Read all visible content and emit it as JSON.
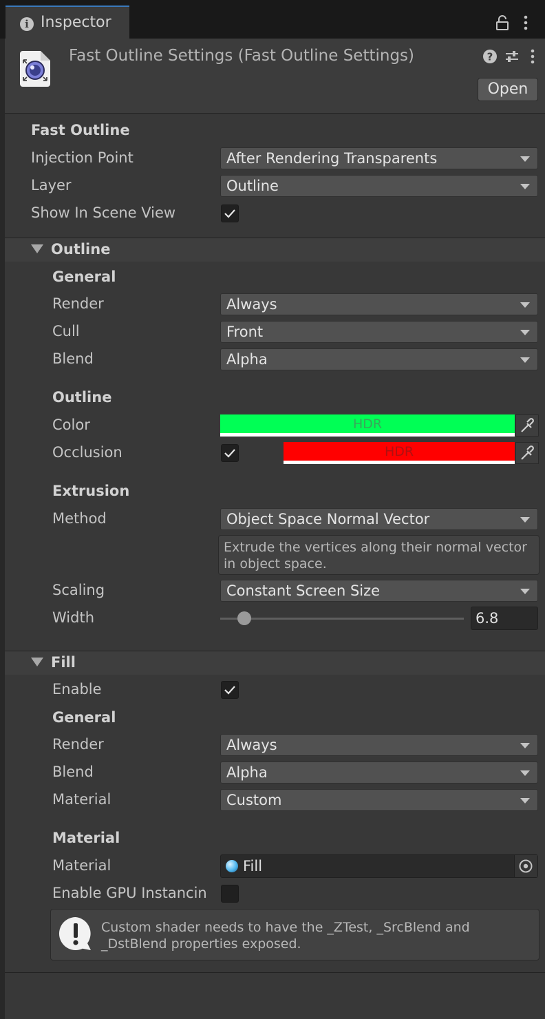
{
  "tab": {
    "title": "Inspector"
  },
  "header": {
    "title": "Fast Outline Settings (Fast Outline Settings)",
    "open_label": "Open",
    "icons": [
      "help-icon",
      "preset-icon",
      "menu-icon"
    ]
  },
  "fast_outline": {
    "heading": "Fast Outline",
    "injection_point": {
      "label": "Injection Point",
      "value": "After Rendering Transparents"
    },
    "layer": {
      "label": "Layer",
      "value": "Outline"
    },
    "show_in_scene_view": {
      "label": "Show In Scene View",
      "checked": true
    }
  },
  "outline": {
    "heading": "Outline",
    "general": {
      "heading": "General",
      "render": {
        "label": "Render",
        "value": "Always"
      },
      "cull": {
        "label": "Cull",
        "value": "Front"
      },
      "blend": {
        "label": "Blend",
        "value": "Alpha"
      }
    },
    "outline_group": {
      "heading": "Outline",
      "color": {
        "label": "Color",
        "hdr": "HDR",
        "swatch": "#00ff55"
      },
      "occlusion": {
        "label": "Occlusion",
        "checked": true,
        "hdr": "HDR",
        "swatch": "#ff0000"
      }
    },
    "extrusion": {
      "heading": "Extrusion",
      "method": {
        "label": "Method",
        "value": "Object Space Normal Vector"
      },
      "method_help_line1": "Extrude the vertices along their normal vector",
      "method_help_line2": "in object space.",
      "scaling": {
        "label": "Scaling",
        "value": "Constant Screen Size"
      },
      "width": {
        "label": "Width",
        "value": "6.8",
        "fraction": 0.09
      }
    }
  },
  "fill": {
    "heading": "Fill",
    "enable": {
      "label": "Enable",
      "checked": true
    },
    "general": {
      "heading": "General",
      "render": {
        "label": "Render",
        "value": "Always"
      },
      "blend": {
        "label": "Blend",
        "value": "Alpha"
      },
      "material": {
        "label": "Material",
        "value": "Custom"
      }
    },
    "material_group": {
      "heading": "Material",
      "material": {
        "label": "Material",
        "value": "Fill"
      },
      "gpu_instancing": {
        "label": "Enable GPU Instancin",
        "checked": false
      }
    },
    "warning_line1": "Custom shader needs to have the _ZTest, _SrcBlend and",
    "warning_line2": "_DstBlend properties exposed."
  },
  "colors": {
    "accent": "#3a79bb",
    "panel": "#383838",
    "field": "#515151"
  }
}
